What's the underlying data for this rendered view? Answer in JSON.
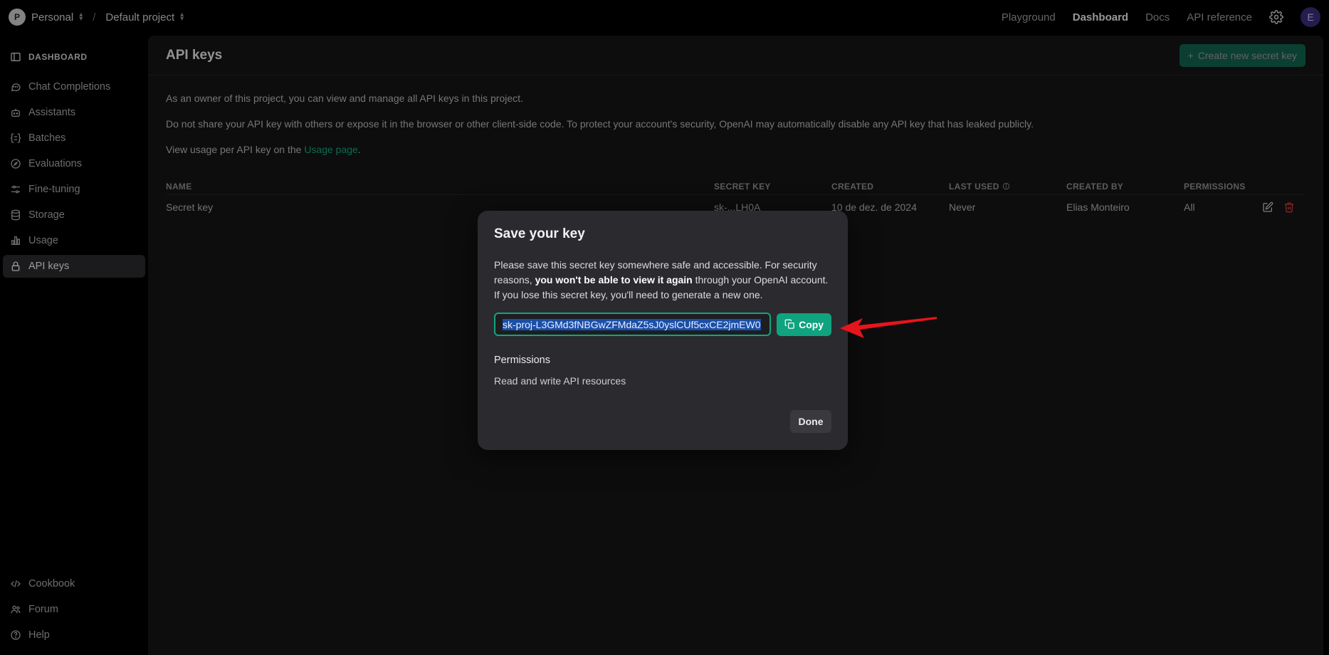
{
  "topbar": {
    "org_initial": "P",
    "org_name": "Personal",
    "project_name": "Default project",
    "separator": "/",
    "nav": [
      "Playground",
      "Dashboard",
      "Docs",
      "API reference"
    ],
    "user_initial": "E"
  },
  "sidebar": {
    "heading": "DASHBOARD",
    "items": [
      {
        "label": "Chat Completions",
        "icon": "chat-bubble-icon"
      },
      {
        "label": "Assistants",
        "icon": "robot-icon"
      },
      {
        "label": "Batches",
        "icon": "batches-icon"
      },
      {
        "label": "Evaluations",
        "icon": "compass-icon"
      },
      {
        "label": "Fine-tuning",
        "icon": "sliders-icon"
      },
      {
        "label": "Storage",
        "icon": "database-icon"
      },
      {
        "label": "Usage",
        "icon": "bar-chart-icon"
      },
      {
        "label": "API keys",
        "icon": "lock-icon"
      }
    ],
    "bottom": [
      {
        "label": "Cookbook",
        "icon": "code-icon"
      },
      {
        "label": "Forum",
        "icon": "people-icon"
      },
      {
        "label": "Help",
        "icon": "help-icon"
      }
    ]
  },
  "main": {
    "title": "API keys",
    "create_button": "Create new secret key",
    "desc1": "As an owner of this project, you can view and manage all API keys in this project.",
    "desc2": "Do not share your API key with others or expose it in the browser or other client-side code. To protect your account's security, OpenAI may automatically disable any API key that has leaked publicly.",
    "desc3_prefix": "View usage per API key on the ",
    "desc3_link": "Usage page",
    "desc3_suffix": ".",
    "table": {
      "headers": [
        "NAME",
        "SECRET KEY",
        "CREATED",
        "LAST USED",
        "CREATED BY",
        "PERMISSIONS"
      ],
      "row": {
        "name": "Secret key",
        "key": "sk-...LH0A",
        "created": "10 de dez. de 2024",
        "last_used": "Never",
        "created_by": "Elias Monteiro",
        "permissions": "All"
      }
    }
  },
  "modal": {
    "title": "Save your key",
    "text_1": "Please save this secret key somewhere safe and accessible. For security reasons, ",
    "text_bold": "you won't be able to view it again",
    "text_2": " through your OpenAI account. If you lose this secret key, you'll need to generate a new one.",
    "key_value": "sk-proj-L3GMd3fNBGwZFMdaZ5sJ0yslCUf5cxCE2jmEW0",
    "copy_label": "Copy",
    "permissions_title": "Permissions",
    "permissions_value": "Read and write API resources",
    "done_label": "Done"
  },
  "colors": {
    "accent": "#10a37f",
    "danger": "#d9363e",
    "annotation_arrow": "#e8141c"
  }
}
